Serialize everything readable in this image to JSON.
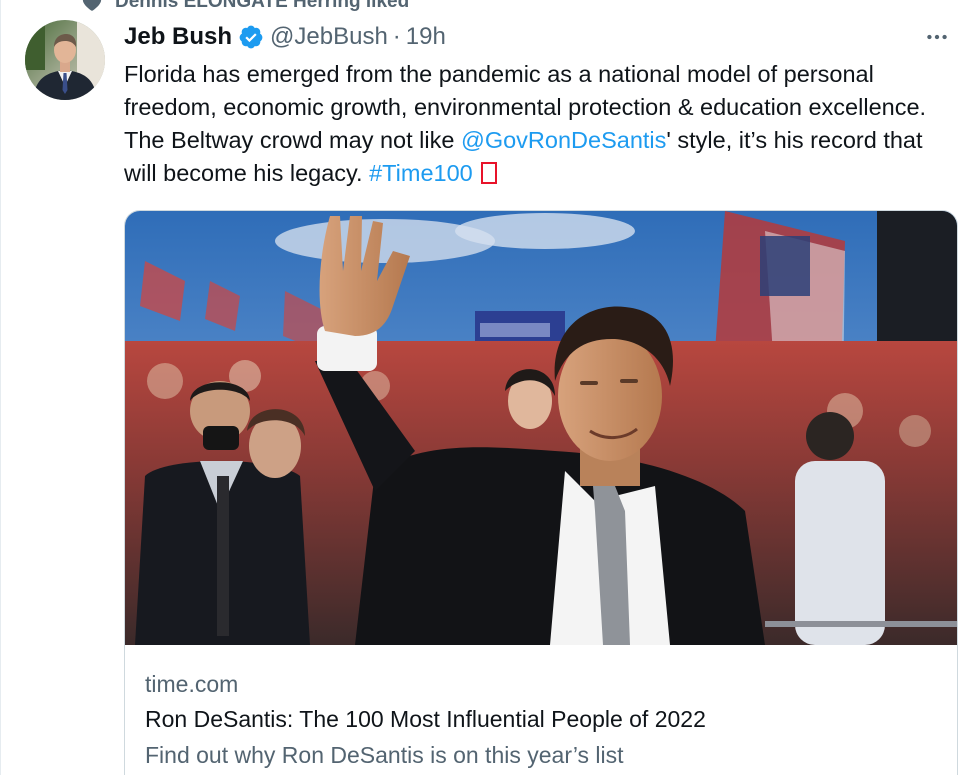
{
  "social_context": {
    "text": "Dennis ELONGATE Herring liked"
  },
  "author": {
    "display_name": "Jeb Bush",
    "handle": "@JebBush",
    "separator": "·",
    "time": "19h",
    "verified": true
  },
  "tweet": {
    "text_part1": "Florida has emerged from the pandemic as a national model of personal freedom, economic growth, environmental protection & education excellence. The Beltway crowd may not like ",
    "mention": "@GovRonDeSantis",
    "text_part2": "' style, it’s his record that will become his legacy. ",
    "hashtag": "#Time100"
  },
  "card": {
    "domain": "time.com",
    "title": "Ron DeSantis: The 100 Most Influential People of 2022",
    "description": "Find out why Ron DeSantis is on this year’s list"
  },
  "colors": {
    "link": "#1d9bf0",
    "verified": "#1d9bf0",
    "secondary_text": "#536471",
    "text": "#0f1419"
  },
  "icons": {
    "social_context": "heart-icon",
    "verified": "verified-badge-icon",
    "more": "more-horizontal-icon"
  }
}
